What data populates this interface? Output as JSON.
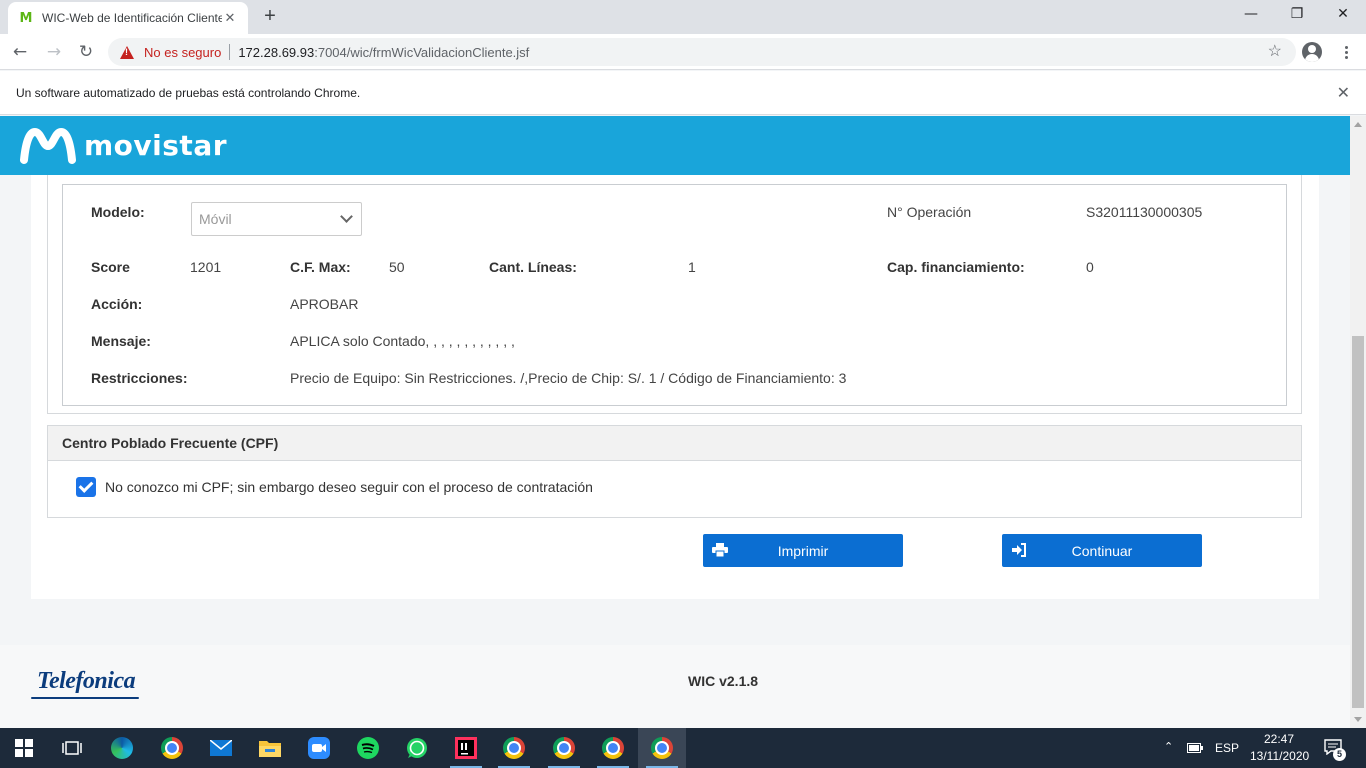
{
  "browser": {
    "tab_title": "WIC-Web de Identificación Cliente",
    "tab_favicon": "M",
    "security_label": "No es seguro",
    "url_host": "172.28.69.93",
    "url_path": ":7004/wic/frmWicValidacionCliente.jsf",
    "infobar_text": "Un software automatizado de pruebas está controlando Chrome."
  },
  "header": {
    "brand": "movistar",
    "brand_color": "#19a5da"
  },
  "evaluation": {
    "modelo_label": "Modelo:",
    "modelo_value": "Móvil",
    "operacion_label": "N° Operación",
    "operacion_value": "S32011130000305",
    "score_label": "Score",
    "score_value": "1201",
    "cfmax_label": "C.F. Max:",
    "cfmax_value": "50",
    "lineas_label": "Cant. Líneas:",
    "lineas_value": "1",
    "capfin_label": "Cap. financiamiento:",
    "capfin_value": "0",
    "accion_label": "Acción:",
    "accion_value": "APROBAR",
    "mensaje_label": "Mensaje:",
    "mensaje_value": "APLICA solo Contado, , , , , , , , , , , ,",
    "restricciones_label": "Restricciones:",
    "restricciones_value": "Precio de Equipo: Sin Restricciones. /,Precio de Chip: S/. 1 / Código de Financiamiento: 3"
  },
  "cpf": {
    "title": "Centro Poblado Frecuente (CPF)",
    "checkbox_label": "No conozco mi CPF; sin embargo deseo seguir con el proceso de contratación",
    "checked": true
  },
  "actions": {
    "print_label": "Imprimir",
    "continue_label": "Continuar",
    "button_color": "#0b6ed2"
  },
  "footer": {
    "company_logo": "Telefonica",
    "version": "WIC v2.1.8"
  },
  "taskbar": {
    "language": "ESP",
    "time": "22:47",
    "date": "13/11/2020",
    "notification_count": "5"
  }
}
